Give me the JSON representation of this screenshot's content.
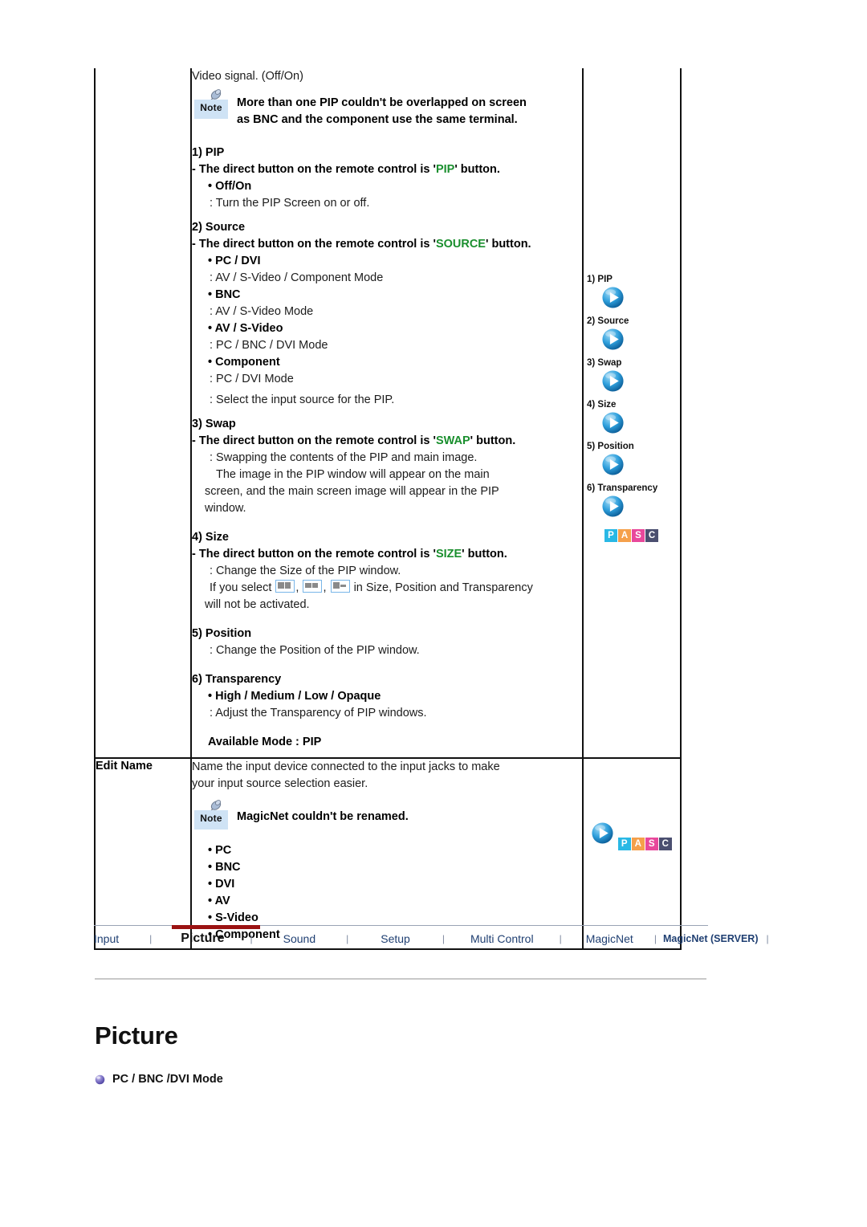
{
  "colors": {
    "accent_green": "#1a8f2e",
    "nav_link": "#1f3f72",
    "nav_active_bar": "#9b1212",
    "note_badge_bg": "#cfe3f5",
    "pasc_p": "#29b8e5",
    "pasc_a": "#f5a04b",
    "pasc_s": "#e8489b",
    "pasc_c": "#4b4f70"
  },
  "table": {
    "pip_row": {
      "label": "",
      "intro": "Video signal. (Off/On)",
      "note": {
        "badge": "Note",
        "text": "More than one PIP couldn't be overlapped on screen as BNC and the component use the same terminal."
      },
      "items": [
        {
          "heading": "1) PIP",
          "direct_prefix": "- The direct button on the remote control is '",
          "direct_key": "PIP",
          "direct_suffix": "' button.",
          "sub": [
            {
              "bullet": "• Off/On",
              "desc": ": Turn the PIP Screen on or off."
            }
          ]
        },
        {
          "heading": "2) Source",
          "direct_prefix": "- The direct button on the remote control is '",
          "direct_key": "SOURCE",
          "direct_suffix": "' button.",
          "sub": [
            {
              "bullet": "• PC / DVI",
              "desc": ": AV / S-Video / Component Mode"
            },
            {
              "bullet": "• BNC",
              "desc": ": AV / S-Video Mode"
            },
            {
              "bullet": "• AV / S-Video",
              "desc": ": PC / BNC / DVI Mode"
            },
            {
              "bullet": "• Component",
              "desc": ": PC / DVI Mode"
            }
          ],
          "tail": ": Select the input source for the PIP."
        },
        {
          "heading": "3) Swap",
          "direct_prefix": "- The direct button on the remote control is '",
          "direct_key": "SWAP",
          "direct_suffix": "' button.",
          "body_line1": ": Swapping the contents of the PIP and main image.",
          "body_line2": "The image in the PIP window will appear on the main",
          "body_line3": "screen, and the main screen image will appear in the PIP",
          "body_line4": "window."
        },
        {
          "heading": "4) Size",
          "direct_prefix": "- The direct button on the remote control is '",
          "direct_key": "SIZE",
          "direct_suffix": "' button.",
          "body_line1": ": Change the Size of the PIP window.",
          "icon_line_prefix": "If you select",
          "icon_line_suffix": "in Size, Position and Transparency",
          "body_line2": "will not be activated."
        },
        {
          "heading": "5) Position",
          "body_line1": ": Change the Position of the PIP window."
        },
        {
          "heading": "6) Transparency",
          "sub": [
            {
              "bullet": "• High / Medium / Low / Opaque",
              "desc": ": Adjust the Transparency of PIP windows."
            }
          ]
        }
      ],
      "available_mode": "Available Mode : PIP",
      "visual_list": [
        "1) PIP",
        "2) Source",
        "3) Swap",
        "4) Size",
        "5) Position",
        "6) Transparency"
      ],
      "pasc": [
        "P",
        "A",
        "S",
        "C"
      ]
    },
    "editname_row": {
      "label": "Edit Name",
      "desc_line1": "Name the input device connected to the input jacks to make",
      "desc_line2": "your input source selection easier.",
      "note": {
        "badge": "Note",
        "text": "MagicNet couldn't be renamed."
      },
      "bullets": [
        "• PC",
        "• BNC",
        "• DVI",
        "• AV",
        "• S-Video",
        "• Component"
      ],
      "pasc": [
        "P",
        "A",
        "S",
        "C"
      ]
    }
  },
  "footer_nav": {
    "items": [
      {
        "label": "Input",
        "active": false,
        "bold": false
      },
      {
        "label": "Picture",
        "active": true,
        "bold": false
      },
      {
        "label": "Sound",
        "active": false,
        "bold": false
      },
      {
        "label": "Setup",
        "active": false,
        "bold": false
      },
      {
        "label": "Multi Control",
        "active": false,
        "bold": false
      },
      {
        "label": "MagicNet",
        "active": false,
        "bold": false
      },
      {
        "label": "MagicNet (SERVER)",
        "active": false,
        "bold": true
      }
    ],
    "separator": "|"
  },
  "page": {
    "title": "Picture",
    "subheading": "PC / BNC /DVI Mode"
  }
}
